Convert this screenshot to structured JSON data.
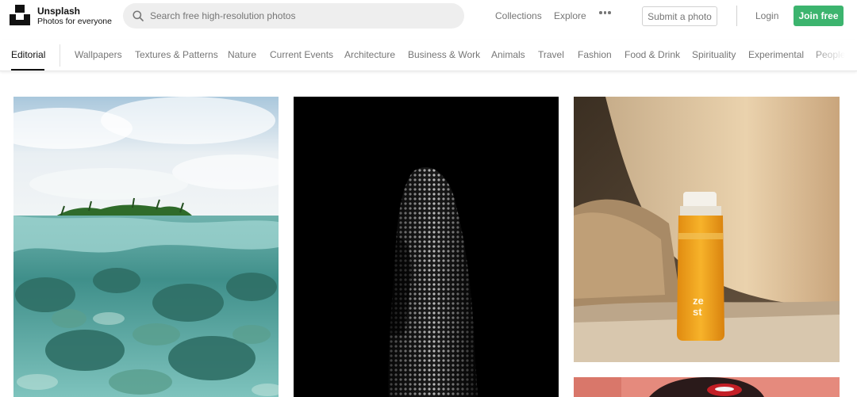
{
  "brand": {
    "name": "Unsplash",
    "tagline": "Photos for everyone"
  },
  "search": {
    "placeholder": "Search free high-resolution photos",
    "value": ""
  },
  "nav": {
    "collections": "Collections",
    "explore": "Explore",
    "more_icon": "more-horizontal-icon",
    "submit": "Submit a photo",
    "login": "Login",
    "join": "Join free"
  },
  "topics": {
    "active": "Editorial",
    "items": [
      "Editorial",
      "Wallpapers",
      "Textures & Patterns",
      "Nature",
      "Current Events",
      "Architecture",
      "Business & Work",
      "Animals",
      "Travel",
      "Fashion",
      "Food & Drink",
      "Spirituality",
      "Experimental",
      "People"
    ]
  },
  "photos": [
    {
      "subject": "island-underwater-split-photo"
    },
    {
      "subject": "dark-architecture-facade-photo"
    },
    {
      "subject": "juice-bottle-on-pillow-photo"
    },
    {
      "subject": "portrait-red-lips-photo"
    }
  ],
  "bottle_label": {
    "line1": "ze",
    "line2": "st"
  },
  "colors": {
    "join_button": "#3cb46e",
    "search_bg": "#eeeeee",
    "muted_text": "#767676"
  }
}
